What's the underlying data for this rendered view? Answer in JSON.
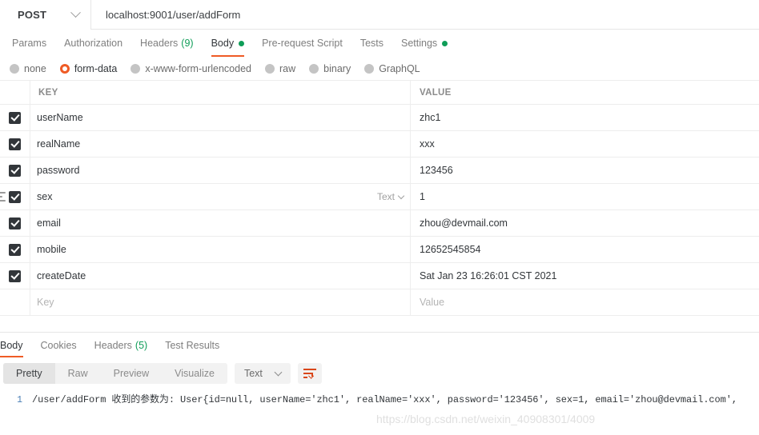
{
  "request": {
    "method": "POST",
    "url": "localhost:9001/user/addForm",
    "tabs": [
      {
        "label": "Params",
        "count": "",
        "dot": false,
        "active": false
      },
      {
        "label": "Authorization",
        "count": "",
        "dot": false,
        "active": false
      },
      {
        "label": "Headers",
        "count": "(9)",
        "dot": false,
        "active": false
      },
      {
        "label": "Body",
        "count": "",
        "dot": true,
        "active": true
      },
      {
        "label": "Pre-request Script",
        "count": "",
        "dot": false,
        "active": false
      },
      {
        "label": "Tests",
        "count": "",
        "dot": false,
        "active": false
      },
      {
        "label": "Settings",
        "count": "",
        "dot": true,
        "active": false
      }
    ],
    "body_types": [
      {
        "label": "none",
        "selected": false
      },
      {
        "label": "form-data",
        "selected": true
      },
      {
        "label": "x-www-form-urlencoded",
        "selected": false
      },
      {
        "label": "raw",
        "selected": false
      },
      {
        "label": "binary",
        "selected": false
      },
      {
        "label": "GraphQL",
        "selected": false
      }
    ],
    "table": {
      "headers": {
        "key": "KEY",
        "value": "VALUE"
      },
      "rows": [
        {
          "checked": true,
          "key": "userName",
          "value": "zhc1",
          "hovered": false,
          "type": "Text"
        },
        {
          "checked": true,
          "key": "realName",
          "value": "xxx",
          "hovered": false,
          "type": "Text"
        },
        {
          "checked": true,
          "key": "password",
          "value": "123456",
          "hovered": false,
          "type": "Text"
        },
        {
          "checked": true,
          "key": "sex",
          "value": "1",
          "hovered": true,
          "type": "Text"
        },
        {
          "checked": true,
          "key": "email",
          "value": "zhou@devmail.com",
          "hovered": false,
          "type": "Text"
        },
        {
          "checked": true,
          "key": "mobile",
          "value": "12652545854",
          "hovered": false,
          "type": "Text"
        },
        {
          "checked": true,
          "key": "createDate",
          "value": "Sat Jan 23 16:26:01 CST 2021",
          "hovered": false,
          "type": "Text"
        }
      ],
      "placeholder": {
        "key": "Key",
        "value": "Value"
      }
    }
  },
  "response": {
    "tabs": [
      {
        "label": "Body",
        "count": "",
        "active": true
      },
      {
        "label": "Cookies",
        "count": "",
        "active": false
      },
      {
        "label": "Headers",
        "count": "(5)",
        "active": false
      },
      {
        "label": "Test Results",
        "count": "",
        "active": false
      }
    ],
    "format_buttons": [
      {
        "label": "Pretty",
        "active": true
      },
      {
        "label": "Raw",
        "active": false
      },
      {
        "label": "Preview",
        "active": false
      },
      {
        "label": "Visualize",
        "active": false
      }
    ],
    "language": "Text",
    "wrap_icon": "word-wrap-icon",
    "body": {
      "line_number": "1",
      "text": "/user/addForm 收到的参数为: User{id=null, userName='zhc1', realName='xxx', password='123456', sex=1, email='zhou@devmail.com',"
    },
    "watermark": "https://blog.csdn.net/weixin_40908301/4009"
  },
  "colors": {
    "accent": "#ef5b25",
    "success": "#0f9d58",
    "text": "#32363a",
    "muted": "#7e7e7e"
  }
}
